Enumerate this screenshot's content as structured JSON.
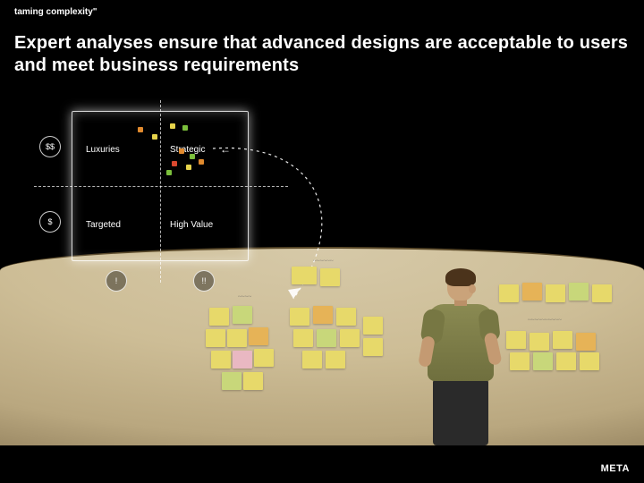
{
  "tagline": "taming complexity\"",
  "headline": "Expert analyses ensure that advanced designs are acceptable to users and meet business requirements",
  "diagram": {
    "y_axis": {
      "high": "$$",
      "low": "$"
    },
    "x_axis": {
      "low": "!",
      "high": "!!"
    },
    "quadrants": {
      "top_left": "Luxuries",
      "top_right": "Strategic",
      "bottom_left": "Targeted",
      "bottom_right": "High Value"
    },
    "arrow_marker": "←"
  },
  "footer_logo": "META"
}
